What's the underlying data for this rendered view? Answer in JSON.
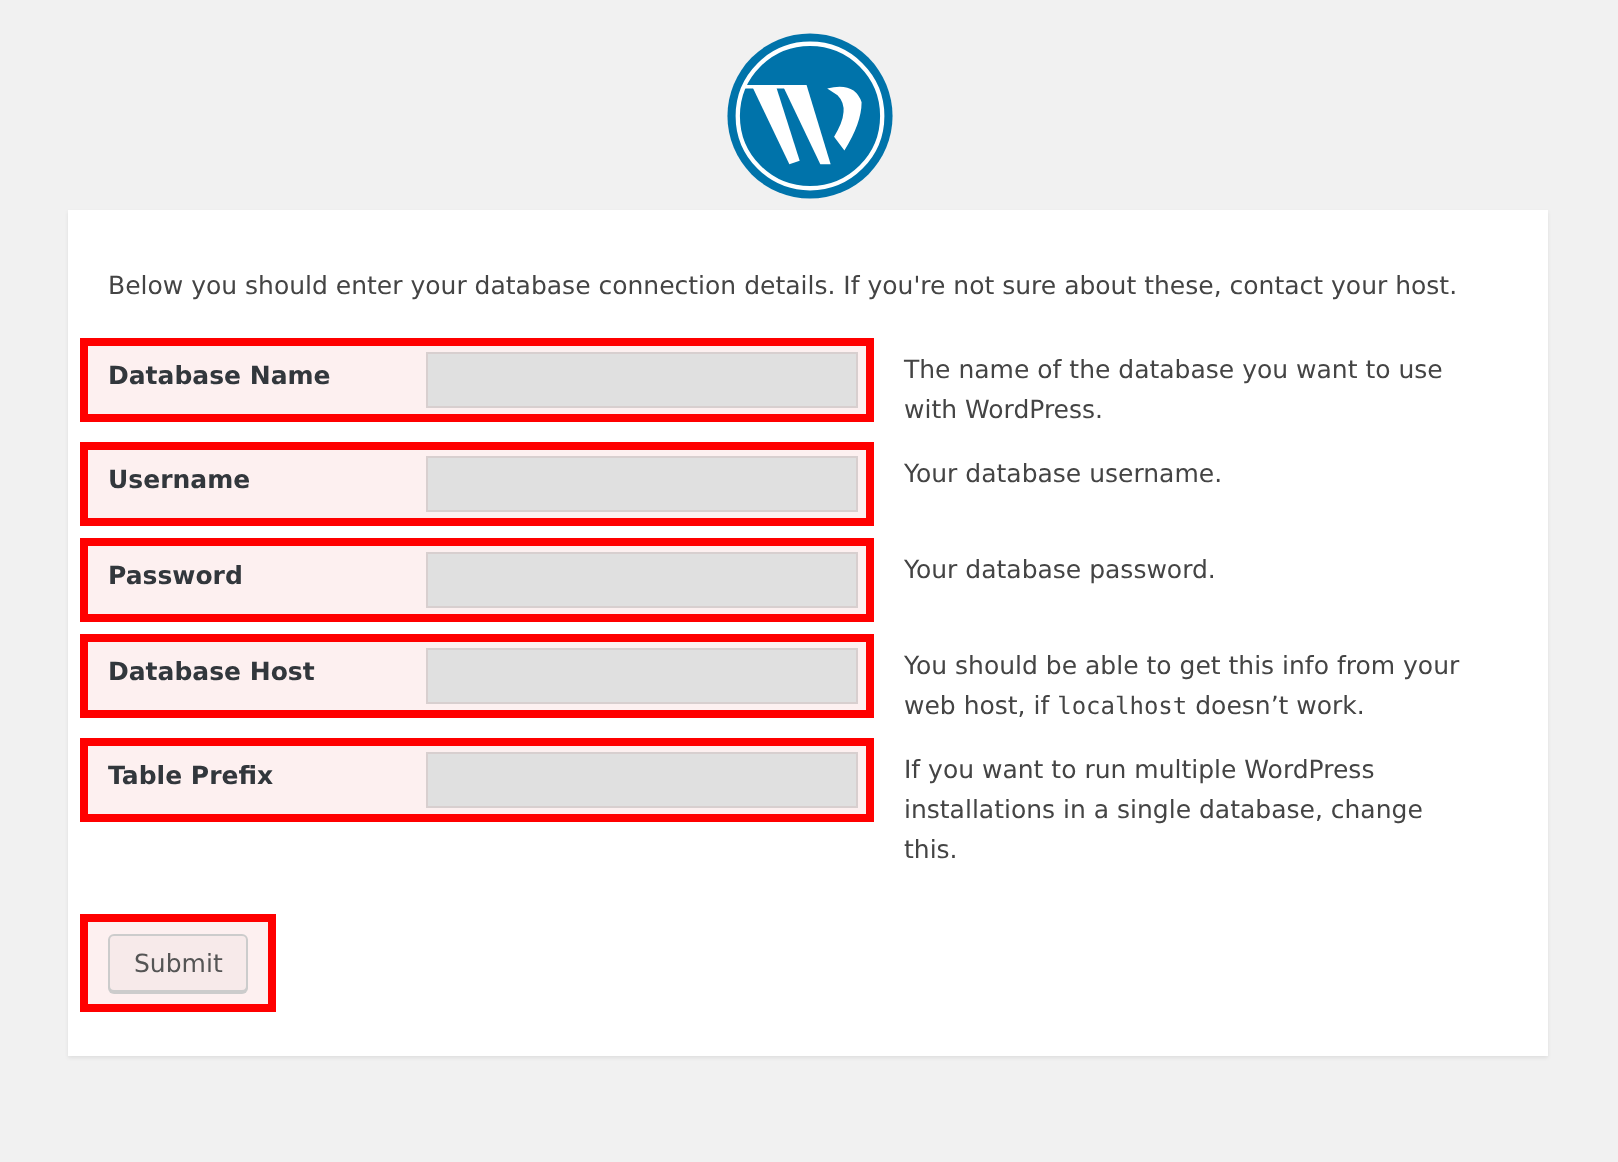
{
  "intro": "Below you should enter your database connection details. If you're not sure about these, contact your host.",
  "fields": [
    {
      "label": "Database Name",
      "highlighted": true,
      "description": [
        {
          "kind": "text",
          "text": "The name of the database you want to use with WordPress."
        }
      ]
    },
    {
      "label": "Username",
      "highlighted": true,
      "description": [
        {
          "kind": "text",
          "text": "Your database username."
        }
      ]
    },
    {
      "label": "Password",
      "highlighted": true,
      "description": [
        {
          "kind": "text",
          "text": "Your database password."
        }
      ]
    },
    {
      "label": "Database Host",
      "highlighted": true,
      "description": [
        {
          "kind": "text",
          "text": "You should be able to get this info from your web host, if "
        },
        {
          "kind": "code",
          "text": "localhost"
        },
        {
          "kind": "text",
          "text": " doesn’t work."
        }
      ]
    },
    {
      "label": "Table Prefix",
      "highlighted": true,
      "description": [
        {
          "kind": "text",
          "text": "If you want to run multiple WordPress installations in a single database, change this."
        }
      ]
    }
  ],
  "submit": {
    "label": "Submit",
    "highlighted": true
  }
}
